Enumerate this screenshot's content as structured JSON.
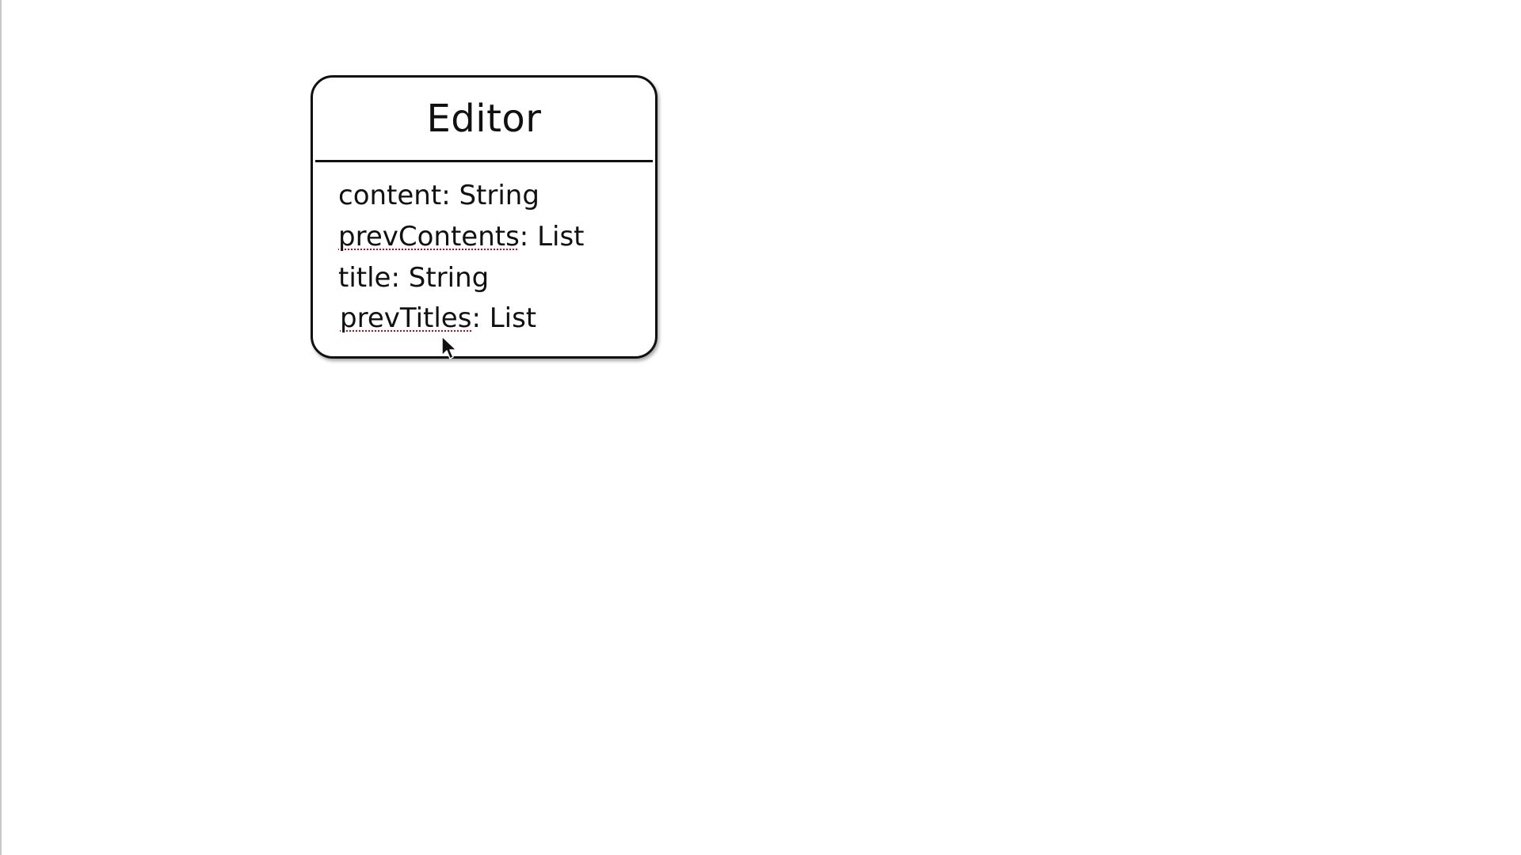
{
  "diagram": {
    "class_name": "Editor",
    "attributes": [
      {
        "name": "content",
        "separator": ": ",
        "type": "String",
        "spellcheck_flag": false
      },
      {
        "name": "prevContents",
        "separator": ": ",
        "type": "List",
        "spellcheck_flag": true
      },
      {
        "name": "title",
        "separator": ": ",
        "type": "String",
        "spellcheck_flag": false
      },
      {
        "name": "prevTitles",
        "separator": ": ",
        "type": "List",
        "spellcheck_flag": true
      }
    ]
  },
  "colors": {
    "background": "#ffffff",
    "outline": "#111111",
    "spellcheck_underline": "#d0021b"
  },
  "icons": {
    "cursor": "mouse-pointer-icon"
  }
}
